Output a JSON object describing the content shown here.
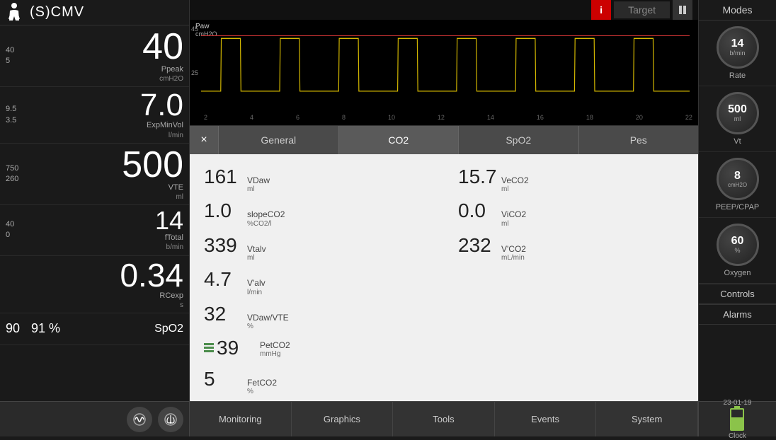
{
  "header": {
    "mode": "(S)CMV",
    "info_label": "i",
    "target_label": "Target"
  },
  "left_panel": {
    "metrics": [
      {
        "upper_limit": "40",
        "lower_limit": "5",
        "value": "40",
        "label": "Ppeak",
        "unit": "cmH2O",
        "size": "large"
      },
      {
        "upper_limit": "9.5",
        "lower_limit": "3.5",
        "value": "7.0",
        "label": "ExpMinVol",
        "unit": "l/min",
        "size": "large"
      },
      {
        "upper_limit": "750",
        "lower_limit": "260",
        "value": "500",
        "label": "VTE",
        "unit": "ml",
        "size": "large"
      },
      {
        "upper_limit": "40",
        "lower_limit": "0",
        "value": "14",
        "label": "fTotal",
        "unit": "b/min",
        "size": "medium"
      }
    ],
    "rc_value": "0.34",
    "rc_label": "RCexp",
    "rc_unit": "s",
    "spo2": {
      "val1": "90",
      "val2": "91 %",
      "label": "SpO2"
    }
  },
  "chart": {
    "y_label": "Paw",
    "y_unit": "cmH2O",
    "y_max": "45",
    "y_mid": "25",
    "x_ticks": [
      "2",
      "4",
      "6",
      "8",
      "10",
      "12",
      "14",
      "16",
      "18",
      "20",
      "22"
    ]
  },
  "modal": {
    "close_label": "×",
    "tabs": [
      {
        "label": "General",
        "active": false
      },
      {
        "label": "CO2",
        "active": true
      },
      {
        "label": "SpO2",
        "active": false
      },
      {
        "label": "Pes",
        "active": false
      }
    ],
    "co2_data": [
      {
        "value": "161",
        "name": "VDaw",
        "unit": "ml"
      },
      {
        "value": "15.7",
        "name": "VeCO2",
        "unit": "ml"
      },
      {
        "value": "1.0",
        "name": "slopeCO2",
        "unit": "%CO2/l"
      },
      {
        "value": "0.0",
        "name": "ViCO2",
        "unit": "ml"
      },
      {
        "value": "339",
        "name": "Vtalv",
        "unit": "ml"
      },
      {
        "value": "232",
        "name": "V'CO2",
        "unit": "mL/min"
      },
      {
        "value": "4.7",
        "name": "V'alv",
        "unit": "l/min"
      },
      {
        "value": "32",
        "name": "VDaw/VTE",
        "unit": "%"
      },
      {
        "value": "39",
        "name": "PetCO2",
        "unit": "mmHg",
        "warning": true
      },
      {
        "value": "5",
        "name": "FetCO2",
        "unit": "%"
      }
    ]
  },
  "right_panel": {
    "modes_label": "Modes",
    "knobs": [
      {
        "value": "14",
        "unit": "b/min",
        "label": "Rate"
      },
      {
        "value": "500",
        "unit": "ml",
        "label": "Vt"
      },
      {
        "value": "8",
        "unit": "cmH2O",
        "label": "PEEP/CPAP"
      },
      {
        "value": "60",
        "unit": "%",
        "label": "Oxygen"
      }
    ],
    "controls_label": "Controls",
    "alarms_label": "Alarms"
  },
  "bottom_bar": {
    "tabs": [
      {
        "label": "Monitoring",
        "active": false
      },
      {
        "label": "Graphics",
        "active": false
      },
      {
        "label": "Tools",
        "active": false
      },
      {
        "label": "Events",
        "active": false
      },
      {
        "label": "System",
        "active": false
      }
    ],
    "datetime": "23-01-19",
    "clock_label": "Clock"
  }
}
